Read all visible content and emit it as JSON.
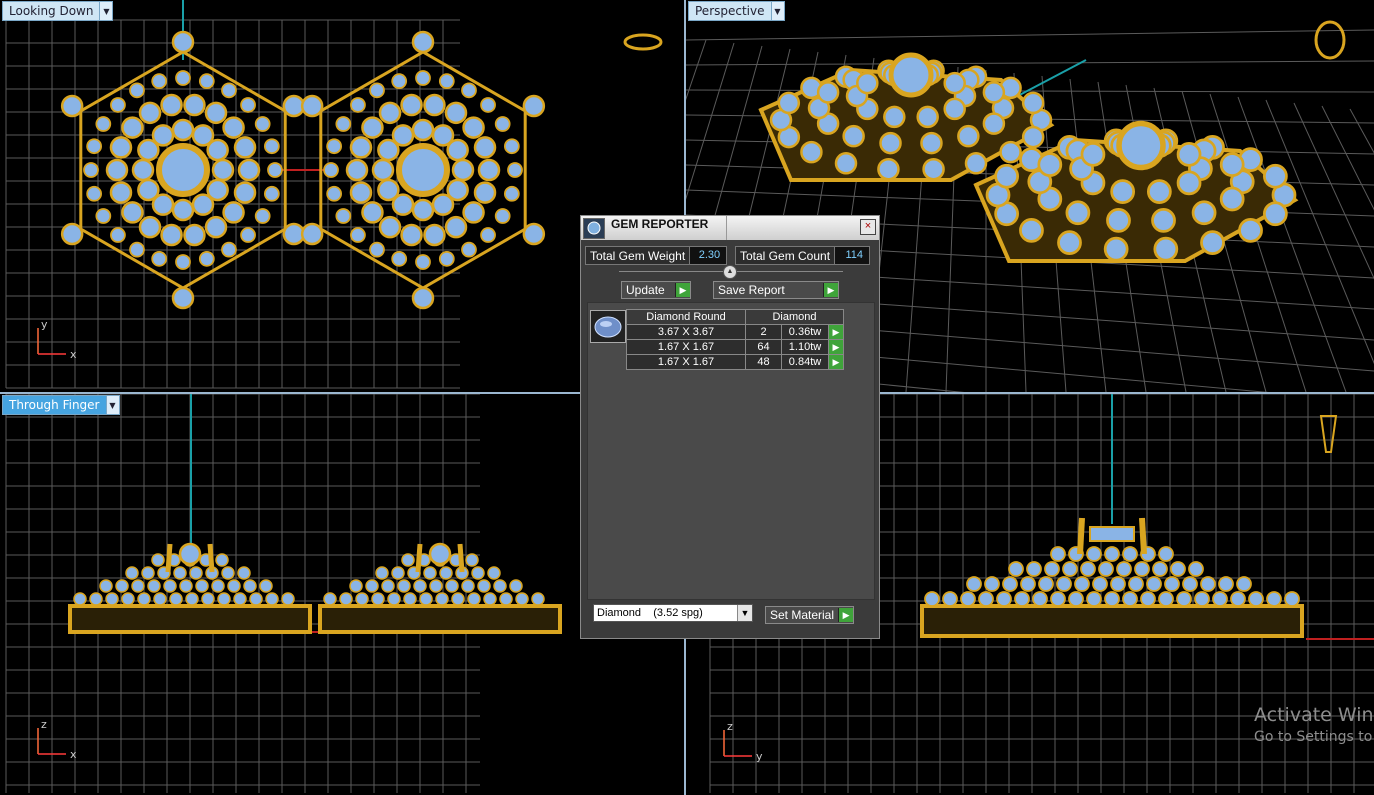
{
  "viewports": {
    "top": {
      "label": "Looking Down",
      "axis1": "y",
      "axis2": "x"
    },
    "persp": {
      "label": "Perspective"
    },
    "front": {
      "label": "Through Finger",
      "axis1": "z",
      "axis2": "x"
    },
    "side": {
      "axis1": "z",
      "axis2": "y"
    }
  },
  "gem_reporter": {
    "title": "GEM REPORTER",
    "total_weight_label": "Total Gem Weight",
    "total_weight_value": "2.30",
    "total_count_label": "Total Gem Count",
    "total_count_value": "114",
    "update_label": "Update",
    "save_report_label": "Save Report",
    "table": {
      "headers": [
        "Diamond Round",
        "Diamond"
      ],
      "rows": [
        {
          "size": "3.67 X 3.67",
          "count": "2",
          "weight": "0.36tw"
        },
        {
          "size": "1.67 X 1.67",
          "count": "64",
          "weight": "1.10tw"
        },
        {
          "size": "1.67 X 1.67",
          "count": "48",
          "weight": "0.84tw"
        }
      ]
    },
    "material_value": "Diamond    (3.52 spg)",
    "set_material_label": "Set Material"
  },
  "watermark": {
    "line1": "Activate Wind",
    "line2": "Go to Settings to"
  },
  "colors": {
    "gold": "#d9a520",
    "gem": "#8ab4e6",
    "grid": "#5a5a5a",
    "accent_green": "#3fa43a",
    "label_active": "#46a4e0"
  }
}
